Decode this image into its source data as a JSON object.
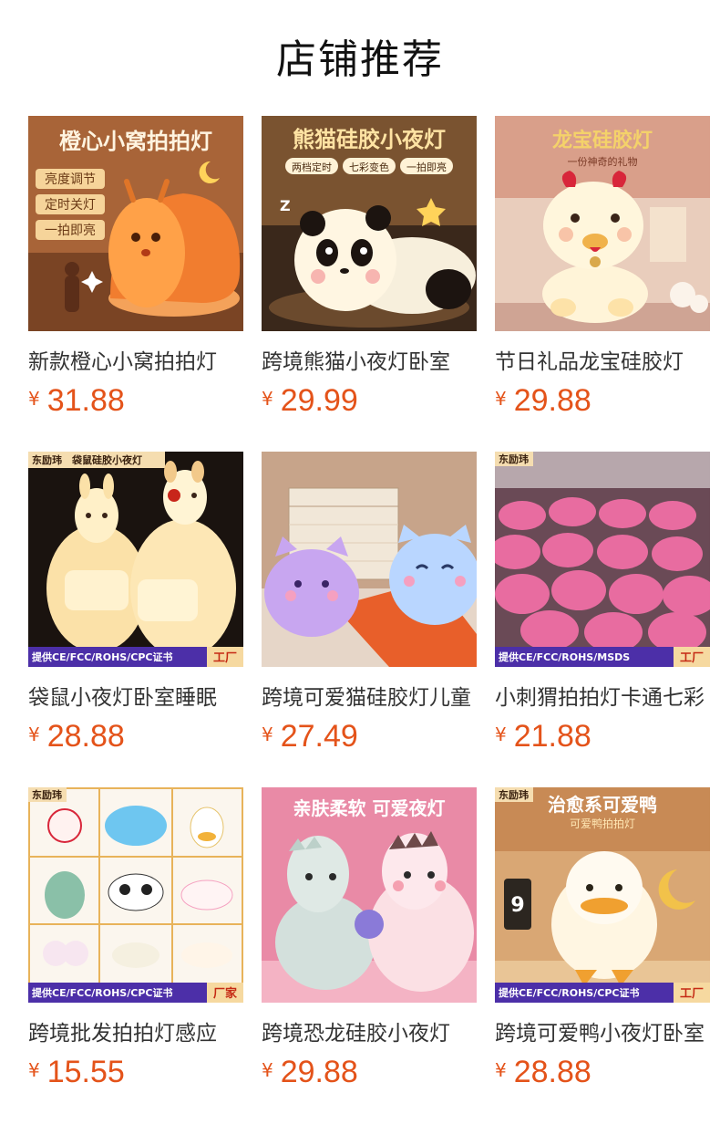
{
  "page": {
    "title": "店铺推荐"
  },
  "products": [
    {
      "name": "新款橙心小窝拍拍灯",
      "currency": "¥",
      "price": "31.88",
      "image": {
        "title": "橙心小窝拍拍灯",
        "tags": [
          "亮度调节",
          "定时关灯",
          "一拍即亮"
        ],
        "bg": "#b06a3c",
        "icon": "orange-snail-lamp"
      }
    },
    {
      "name": "跨境熊猫小夜灯卧室",
      "currency": "¥",
      "price": "29.99",
      "image": {
        "title": "熊猫硅胶小夜灯",
        "tags": [
          "两档定时",
          "七彩变色",
          "一拍即亮"
        ],
        "bg": "#3b2a1d",
        "icon": "panda-lamp"
      }
    },
    {
      "name": "节日礼品龙宝硅胶灯",
      "currency": "¥",
      "price": "29.88",
      "image": {
        "title": "龙宝硅胶灯",
        "subtitle": "一份神奇的礼物",
        "bg": "#e7c8b7",
        "icon": "dragon-lamp"
      }
    },
    {
      "name": "袋鼠小夜灯卧室睡眠",
      "currency": "¥",
      "price": "28.88",
      "image": {
        "brand": "东励玮",
        "title": "袋鼠硅胶小夜灯",
        "cert": "提供CE/FCC/ROHS/CPC证书",
        "badge": "工厂",
        "bg": "#1b1410",
        "icon": "kangaroo-lamp"
      }
    },
    {
      "name": "跨境可爱猫硅胶灯儿童",
      "currency": "¥",
      "price": "27.49",
      "image": {
        "bg": "#c6a58a",
        "icon": "cat-lamp"
      }
    },
    {
      "name": "小刺猬拍拍灯卡通七彩",
      "currency": "¥",
      "price": "21.88",
      "image": {
        "brand": "东励玮",
        "cert": "提供CE/FCC/ROHS/MSDS",
        "badge": "工厂",
        "bg": "#6d4c58",
        "icon": "hedgehog-lamps"
      }
    },
    {
      "name": "跨境批发拍拍灯感应",
      "currency": "¥",
      "price": "15.55",
      "image": {
        "brand": "东励玮",
        "cert": "提供CE/FCC/ROHS/CPC证书",
        "badge": "厂家",
        "bg": "#fbf6ee",
        "icon": "lamp-collection-grid"
      }
    },
    {
      "name": "跨境恐龙硅胶小夜灯",
      "currency": "¥",
      "price": "29.88",
      "image": {
        "title": "亲肤柔软 可爱夜灯",
        "bg": "#e98aa6",
        "icon": "dinosaur-lamp"
      }
    },
    {
      "name": "跨境可爱鸭小夜灯卧室",
      "currency": "¥",
      "price": "28.88",
      "image": {
        "brand": "东励玮",
        "title": "治愈系可爱鸭",
        "subtitle": "可爱鸭拍拍灯",
        "cert": "提供CE/FCC/ROHS/CPC证书",
        "badge": "工厂",
        "bg": "#d9a774",
        "icon": "duck-lamp"
      }
    }
  ]
}
